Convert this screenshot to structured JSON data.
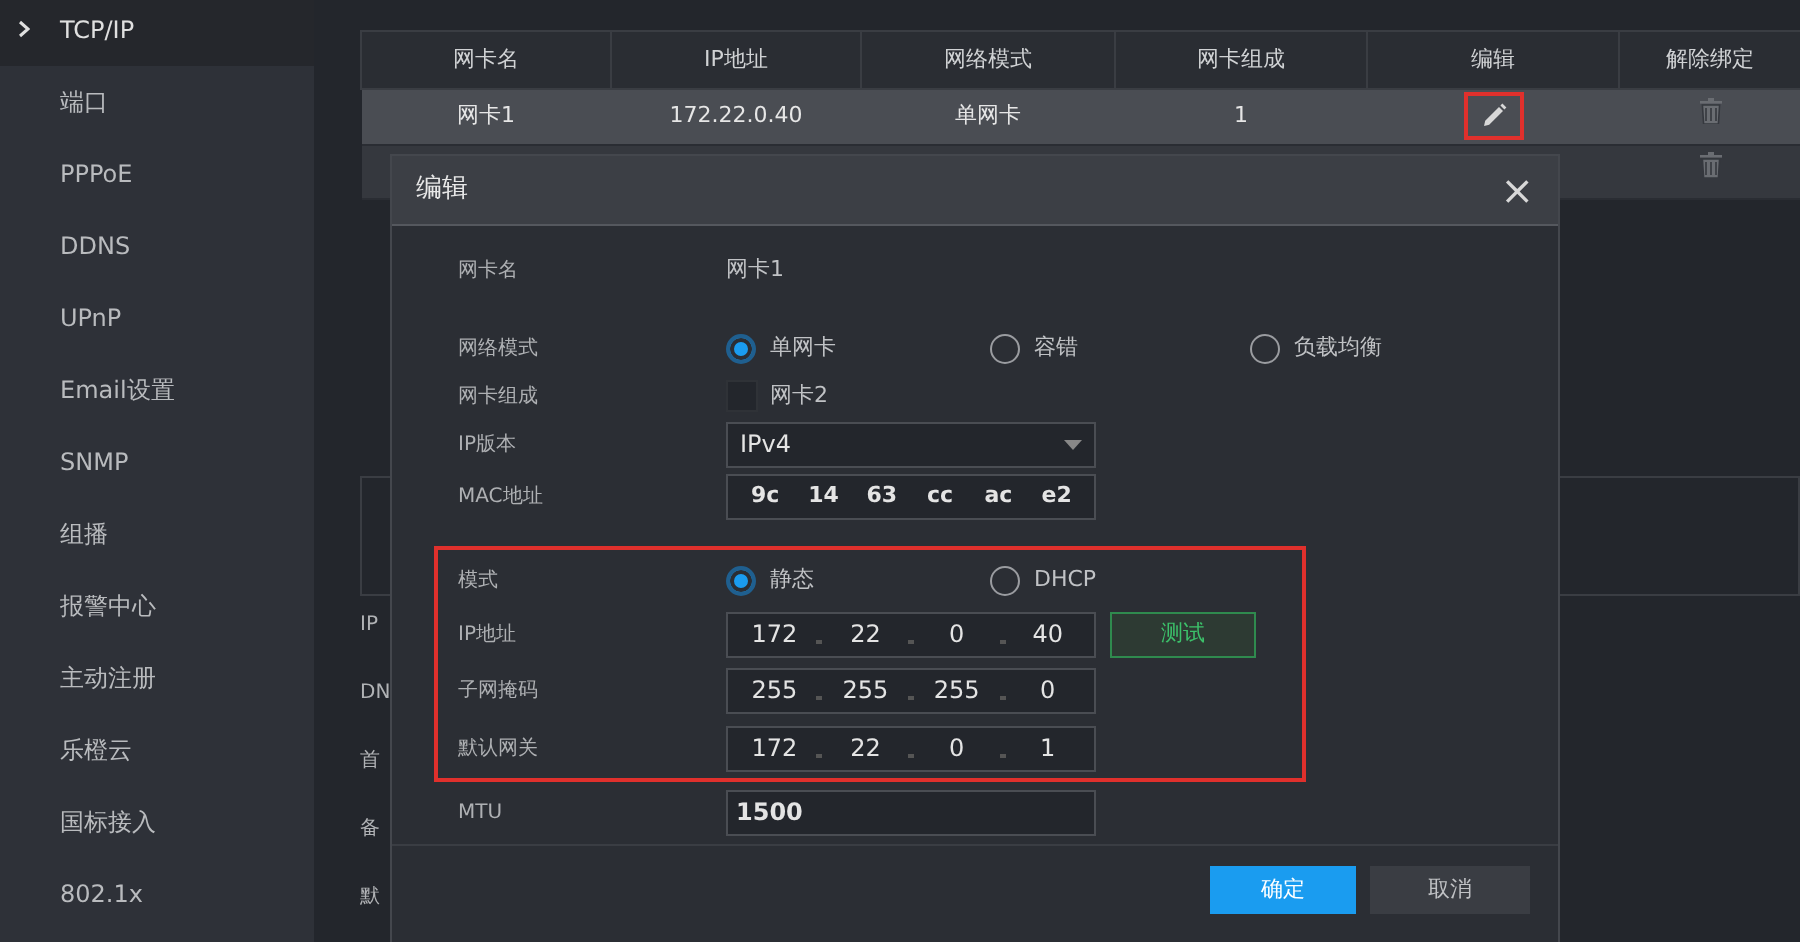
{
  "sidebar": {
    "items": [
      {
        "label": "TCP/IP",
        "selected": true
      },
      {
        "label": "端口",
        "selected": false
      },
      {
        "label": "PPPoE",
        "selected": false
      },
      {
        "label": "DDNS",
        "selected": false
      },
      {
        "label": "UPnP",
        "selected": false
      },
      {
        "label": "Email设置",
        "selected": false
      },
      {
        "label": "SNMP",
        "selected": false
      },
      {
        "label": "组播",
        "selected": false
      },
      {
        "label": "报警中心",
        "selected": false
      },
      {
        "label": "主动注册",
        "selected": false
      },
      {
        "label": "乐橙云",
        "selected": false
      },
      {
        "label": "国标接入",
        "selected": false
      },
      {
        "label": "802.1x",
        "selected": false
      }
    ]
  },
  "table": {
    "columns": [
      "网卡名",
      "IP地址",
      "网络模式",
      "网卡组成",
      "编辑",
      "解除绑定"
    ],
    "rows": [
      {
        "cells": [
          "网卡1",
          "172.22.0.40",
          "单网卡",
          "1"
        ],
        "selected": true,
        "edit_highlighted": true
      },
      {
        "cells": [],
        "selected": false,
        "edit_highlighted": false
      }
    ]
  },
  "background_labels": [
    "IP",
    "DN",
    "首",
    "备",
    "默"
  ],
  "dialog": {
    "title": "编辑",
    "close": "×",
    "nic_name": {
      "label": "网卡名",
      "value": "网卡1"
    },
    "network_mode": {
      "label": "网络模式",
      "options": [
        {
          "label": "单网卡",
          "selected": true
        },
        {
          "label": "容错",
          "selected": false
        },
        {
          "label": "负载均衡",
          "selected": false
        }
      ]
    },
    "nic_members": {
      "label": "网卡组成",
      "options": [
        {
          "label": "网卡2",
          "checked": false
        }
      ]
    },
    "ip_version": {
      "label": "IP版本",
      "value": "IPv4"
    },
    "mac": {
      "label": "MAC地址",
      "parts": [
        "9c",
        "14",
        "63",
        "cc",
        "ac",
        "e2"
      ]
    },
    "highlighted_section": true,
    "mode": {
      "label": "模式",
      "options": [
        {
          "label": "静态",
          "selected": true
        },
        {
          "label": "DHCP",
          "selected": false
        }
      ]
    },
    "ip_address": {
      "label": "IP地址",
      "parts": [
        "172",
        "22",
        "0",
        "40"
      ],
      "button": "测试"
    },
    "subnet_mask": {
      "label": "子网掩码",
      "parts": [
        "255",
        "255",
        "255",
        "0"
      ]
    },
    "gateway": {
      "label": "默认网关",
      "parts": [
        "172",
        "22",
        "0",
        "1"
      ]
    },
    "mtu": {
      "label": "MTU",
      "value": "1500"
    },
    "buttons": [
      {
        "label": "确定",
        "kind": "primary"
      },
      {
        "label": "取消",
        "kind": "secondary"
      }
    ]
  }
}
